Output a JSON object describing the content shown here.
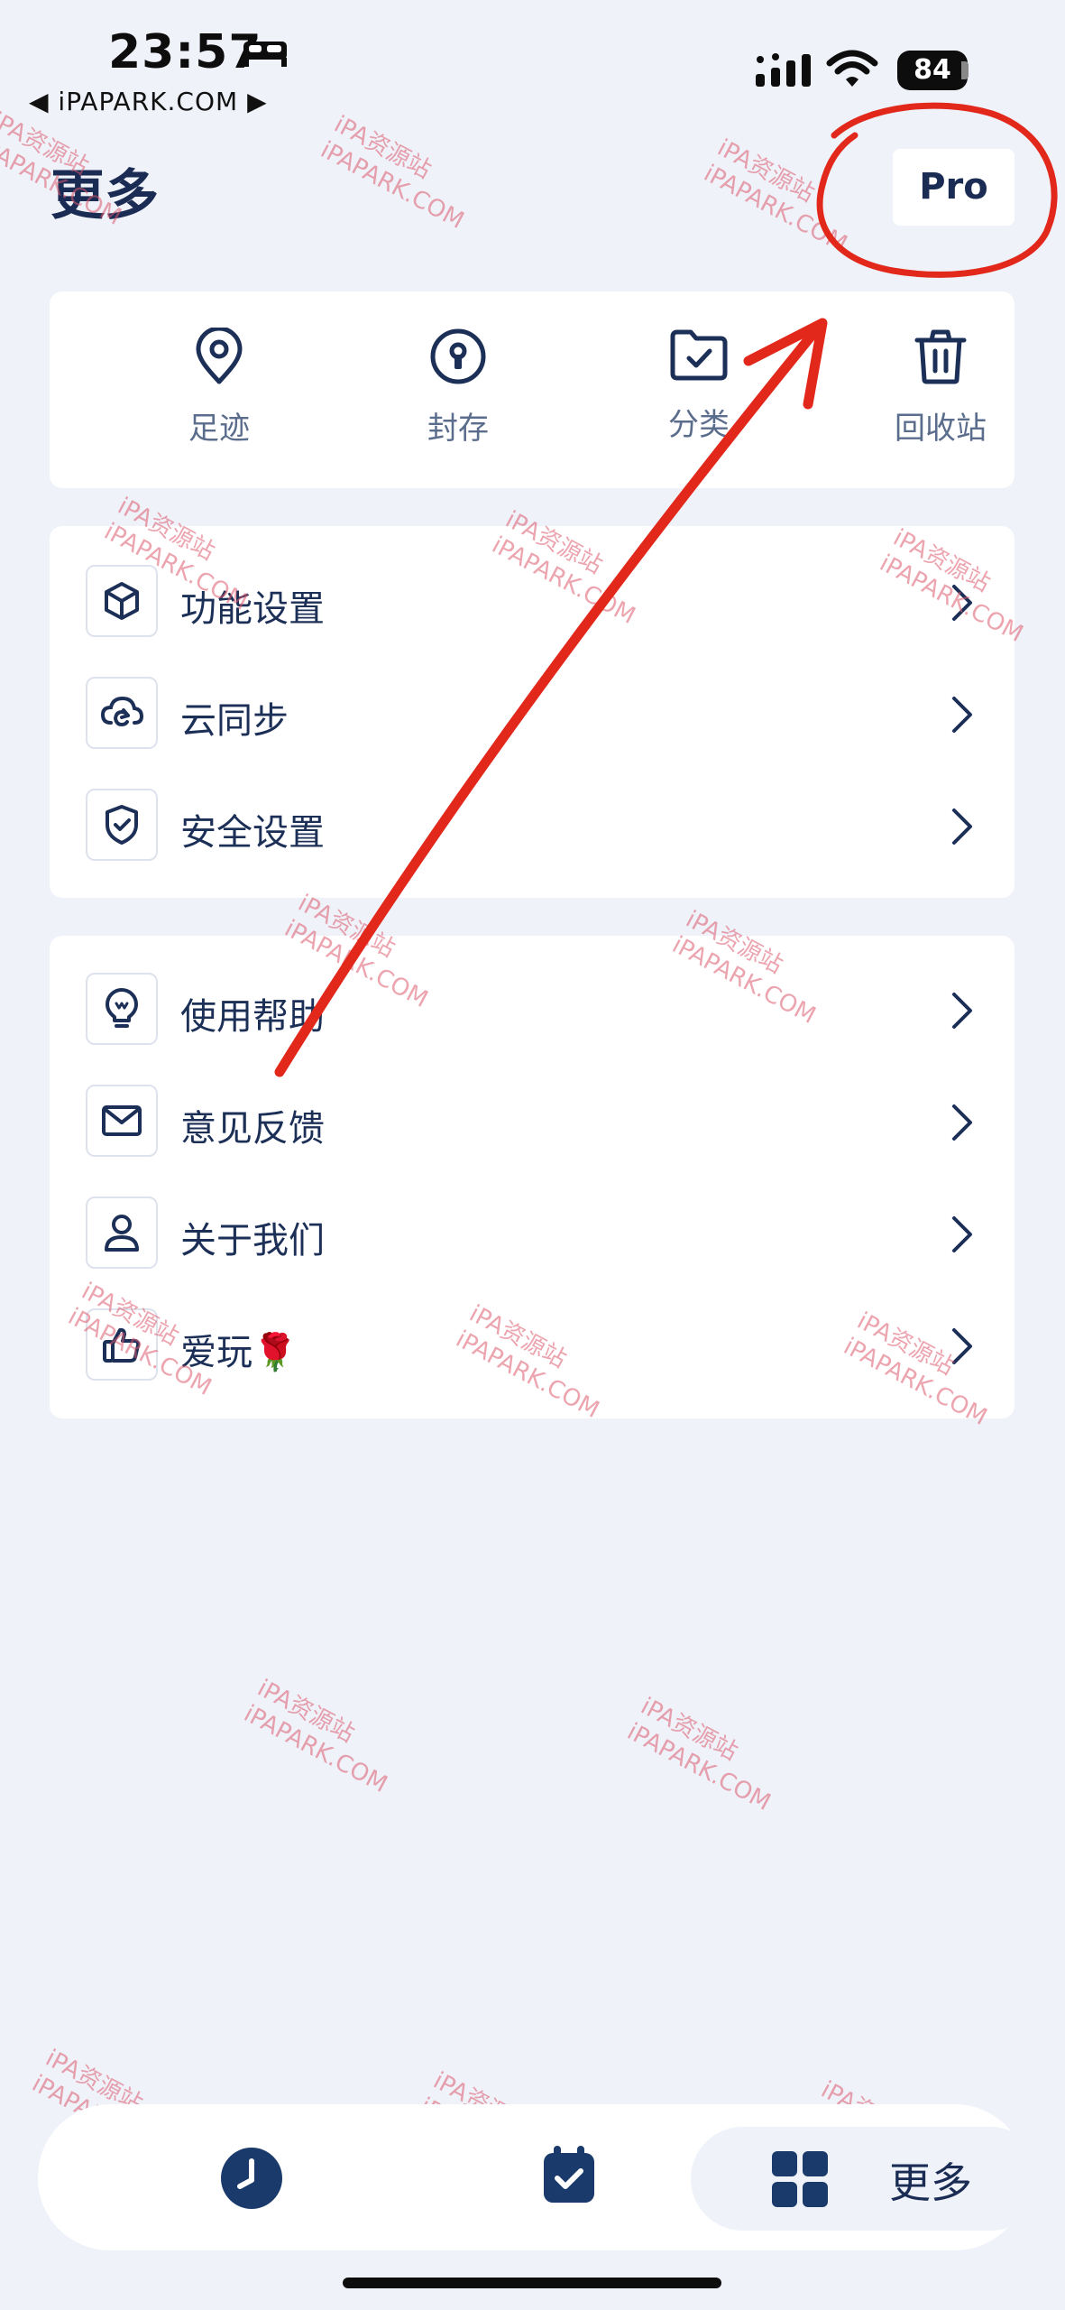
{
  "status_bar": {
    "time": "23:57",
    "carrier": "◀ iPAPARK.COM ▶",
    "battery": "84"
  },
  "header": {
    "title": "更多",
    "pro_label": "Pro"
  },
  "quick_actions": [
    {
      "label": "足迹",
      "icon": "location-pin-icon"
    },
    {
      "label": "封存",
      "icon": "archive-lock-icon"
    },
    {
      "label": "分类",
      "icon": "folder-check-icon"
    },
    {
      "label": "回收站",
      "icon": "trash-icon"
    }
  ],
  "settings": [
    {
      "label": "功能设置",
      "icon": "box-icon"
    },
    {
      "label": "云同步",
      "icon": "cloud-sync-icon"
    },
    {
      "label": "安全设置",
      "icon": "shield-check-icon"
    }
  ],
  "help": [
    {
      "label": "使用帮助",
      "icon": "lightbulb-icon"
    },
    {
      "label": "意见反馈",
      "icon": "mail-icon"
    },
    {
      "label": "关于我们",
      "icon": "user-icon"
    },
    {
      "label": "爱玩🌹",
      "icon": "thumbs-up-icon"
    }
  ],
  "tab_bar": {
    "tabs": [
      {
        "name": "history",
        "icon": "clock-icon"
      },
      {
        "name": "tasks",
        "icon": "calendar-check-icon"
      },
      {
        "name": "more",
        "icon": "grid-icon",
        "label": "更多"
      }
    ],
    "active": "more"
  },
  "watermark": {
    "line1": "iPA资源站",
    "line2": "iPAPARK.COM"
  },
  "colors": {
    "primary": "#1a2c54",
    "background": "#eff2f9",
    "card": "#ffffff",
    "annotation": "#e2281b",
    "watermark": "#dc5a6e"
  }
}
